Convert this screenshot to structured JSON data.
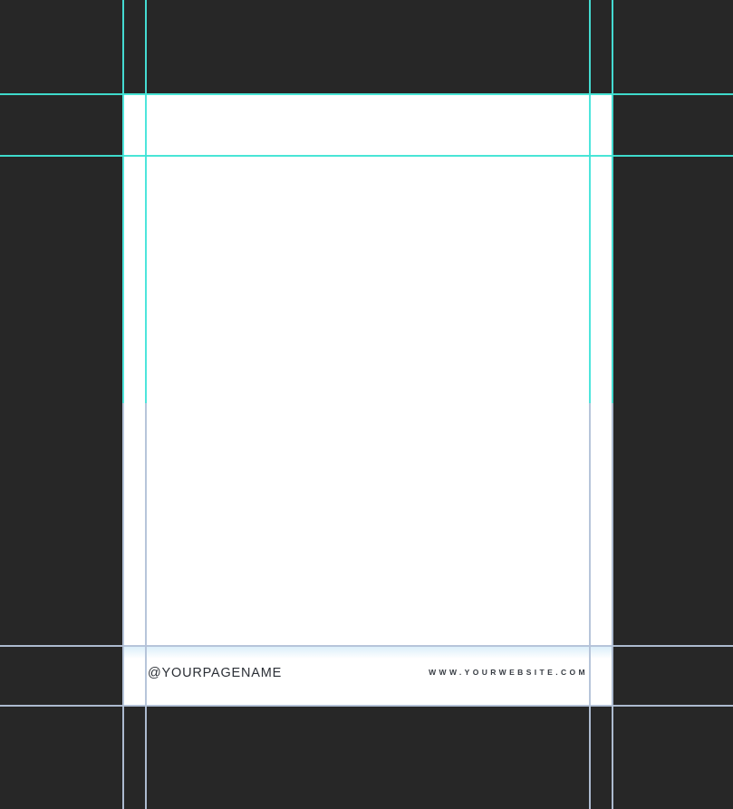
{
  "canvas": {
    "footer": {
      "page_handle": "@YOURPAGENAME",
      "website": "WWW.YOURWEBSITE.COM"
    },
    "colors": {
      "pasteboard_background": "#272727",
      "page_background": "#ffffff",
      "guide_turquoise": "#45e4da",
      "guide_pale_blue": "#b3c2d8",
      "footer_text": "#2b2f36",
      "footer_glow": "#badef4"
    },
    "guides": {
      "vertical_names": [
        "outer-left",
        "inner-left",
        "inner-right",
        "outer-right"
      ],
      "horizontal_names": [
        "top-outer",
        "top-inner",
        "bottom-inner",
        "bottom-outer"
      ]
    }
  }
}
